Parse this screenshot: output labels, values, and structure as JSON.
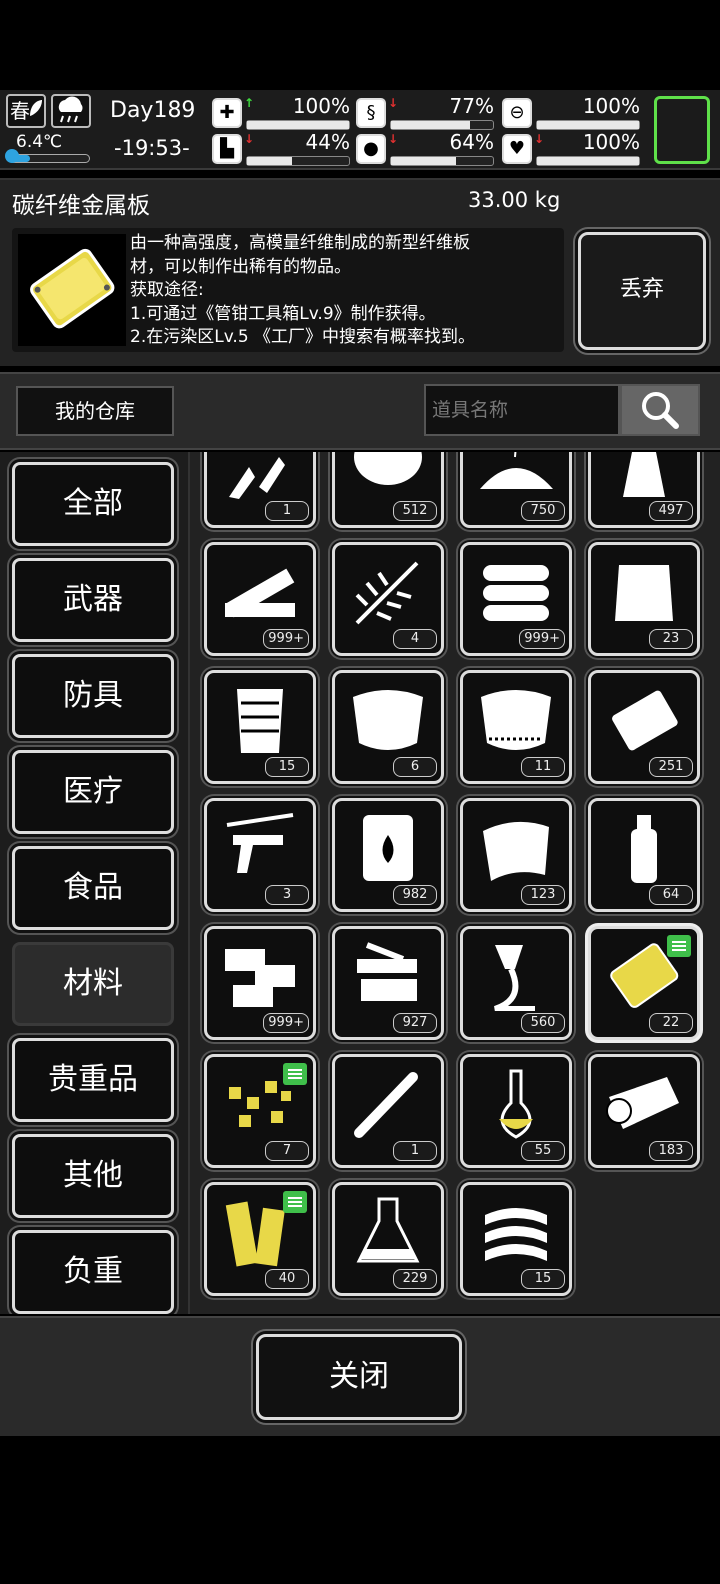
{
  "status": {
    "season": "春",
    "temperature": "6.4℃",
    "temperature_level": 0.26,
    "day": "Day189",
    "time": "-19:53-",
    "stats": [
      {
        "name": "health",
        "icon": "medkit-icon",
        "arrow": "up",
        "value": "100%",
        "level": 1.0
      },
      {
        "name": "hunger",
        "icon": "stomach-icon",
        "arrow": "down",
        "value": "77%",
        "level": 0.77
      },
      {
        "name": "sanity",
        "icon": "pill-icon",
        "arrow": "none",
        "value": "100%",
        "level": 1.0
      },
      {
        "name": "stamina",
        "icon": "boot-icon",
        "arrow": "down",
        "value": "44%",
        "level": 0.44
      },
      {
        "name": "thirst",
        "icon": "water-drop-icon",
        "arrow": "down",
        "value": "64%",
        "level": 0.64
      },
      {
        "name": "mood",
        "icon": "heart-icon",
        "arrow": "down",
        "value": "100%",
        "level": 1.0
      }
    ],
    "accent_green": "#5fe04a"
  },
  "item": {
    "name": "碳纤维金属板",
    "weight": "33.00 kg",
    "description_lines": [
      "由一种高强度，高模量纤维制成的新型纤维板",
      "材，可以制作出稀有的物品。",
      "获取途径:",
      "1.可通过《管钳工具箱Lv.9》制作获得。",
      "2.在污染区Lv.5 《工厂》中搜索有概率找到。"
    ],
    "discard_label": "丢弃"
  },
  "warehouse": {
    "button_label": "我的仓库",
    "search_placeholder": "道具名称"
  },
  "categories": [
    {
      "label": "全部",
      "active": false
    },
    {
      "label": "武器",
      "active": false
    },
    {
      "label": "防具",
      "active": false
    },
    {
      "label": "医疗",
      "active": false
    },
    {
      "label": "食品",
      "active": false
    },
    {
      "label": "材料",
      "active": true
    },
    {
      "label": "贵重品",
      "active": false
    },
    {
      "label": "其他",
      "active": false
    },
    {
      "label": "负重",
      "active": false
    }
  ],
  "items": [
    {
      "icon": "broken-glass-icon",
      "count": "1"
    },
    {
      "icon": "fur-ball-icon",
      "count": "512"
    },
    {
      "icon": "soil-pile-icon",
      "count": "750"
    },
    {
      "icon": "spray-bottle-icon",
      "count": "497"
    },
    {
      "icon": "wood-planks-icon",
      "count": "999+"
    },
    {
      "icon": "fern-leaves-icon",
      "count": "4"
    },
    {
      "icon": "logs-icon",
      "count": "999+"
    },
    {
      "icon": "sack-icon",
      "count": "23"
    },
    {
      "icon": "hide-striped-icon",
      "count": "15"
    },
    {
      "icon": "leather-hide-icon",
      "count": "6"
    },
    {
      "icon": "furry-hide-icon",
      "count": "11"
    },
    {
      "icon": "metal-plate-icon",
      "count": "251"
    },
    {
      "icon": "pistol-parts-icon",
      "count": "3"
    },
    {
      "icon": "fuel-barrel-icon",
      "count": "982"
    },
    {
      "icon": "sheet-metal-icon",
      "count": "123"
    },
    {
      "icon": "plastic-bottle-icon",
      "count": "64"
    },
    {
      "icon": "bricks-icon",
      "count": "999+"
    },
    {
      "icon": "machine-parts-icon",
      "count": "927"
    },
    {
      "icon": "glue-tube-icon",
      "count": "560"
    },
    {
      "icon": "carbon-fiber-plate-icon",
      "count": "22",
      "selected": true,
      "note": true,
      "color": "#e8d848"
    },
    {
      "icon": "gold-nuggets-icon",
      "count": "7",
      "note": true,
      "color": "#e8d848"
    },
    {
      "icon": "metal-rod-icon",
      "count": "1"
    },
    {
      "icon": "flask-icon",
      "count": "55",
      "color": "#e8d848"
    },
    {
      "icon": "rolled-cloth-icon",
      "count": "183"
    },
    {
      "icon": "gold-wood-icon",
      "count": "40",
      "note": true,
      "color": "#e8d848"
    },
    {
      "icon": "beaker-icon",
      "count": "229"
    },
    {
      "icon": "tape-roll-icon",
      "count": "15"
    }
  ],
  "close_label": "关闭"
}
